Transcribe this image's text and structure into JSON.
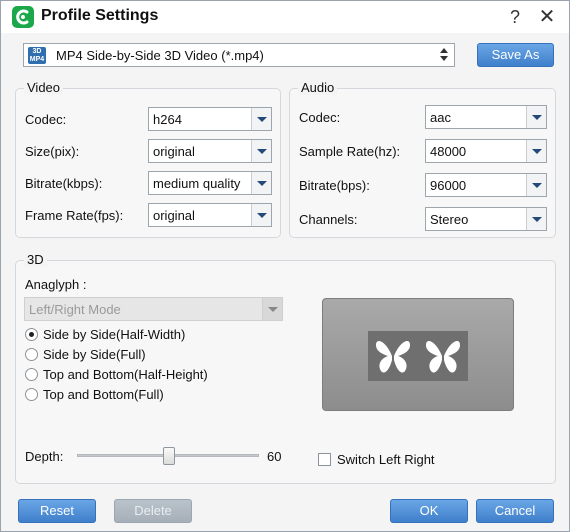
{
  "window": {
    "title": "Profile Settings",
    "help_glyph": "?",
    "close_glyph": "✕"
  },
  "format": {
    "icon_top": "3D",
    "icon_bottom": "MP4",
    "value": "MP4 Side-by-Side 3D Video (*.mp4)",
    "save_as_label": "Save As"
  },
  "video": {
    "title": "Video",
    "codec": {
      "label": "Codec:",
      "value": "h264"
    },
    "size": {
      "label": "Size(pix):",
      "value": "original"
    },
    "bitrate": {
      "label": "Bitrate(kbps):",
      "value": "medium quality"
    },
    "frame_rate": {
      "label": "Frame Rate(fps):",
      "value": "original"
    }
  },
  "audio": {
    "title": "Audio",
    "codec": {
      "label": "Codec:",
      "value": "aac"
    },
    "sample_rate": {
      "label": "Sample Rate(hz):",
      "value": "48000"
    },
    "bitrate": {
      "label": "Bitrate(bps):",
      "value": "96000"
    },
    "channels": {
      "label": "Channels:",
      "value": "Stereo"
    }
  },
  "three_d": {
    "title": "3D",
    "anaglyph_label": "Anaglyph :",
    "anaglyph_value": "Left/Right Mode",
    "modes": [
      {
        "label": "Side by Side(Half-Width)",
        "checked": true
      },
      {
        "label": "Side by Side(Full)",
        "checked": false
      },
      {
        "label": "Top and Bottom(Half-Height)",
        "checked": false
      },
      {
        "label": "Top and Bottom(Full)",
        "checked": false
      }
    ],
    "depth_label": "Depth:",
    "depth_value": "60",
    "switch_label": "Switch Left Right",
    "switch_checked": false
  },
  "buttons": {
    "reset": "Reset",
    "delete": "Delete",
    "ok": "OK",
    "cancel": "Cancel"
  },
  "colors": {
    "accent": "#3f7fcb",
    "app_icon": "#1aa84a"
  },
  "icons": [
    "app-logo-icon",
    "help-icon",
    "close-icon",
    "mp4-3d-icon",
    "butterfly-icon"
  ]
}
